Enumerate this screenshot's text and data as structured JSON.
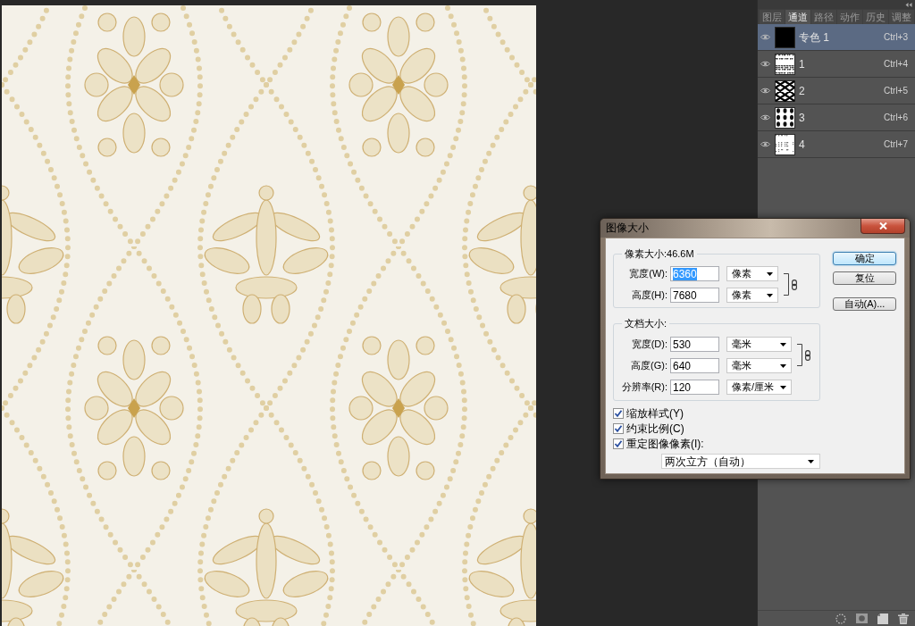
{
  "panel": {
    "tabs": [
      {
        "label": "图层",
        "selected": false
      },
      {
        "label": "通道",
        "selected": true
      },
      {
        "label": "路径",
        "selected": false
      },
      {
        "label": "动作",
        "selected": false
      },
      {
        "label": "历史",
        "selected": false
      },
      {
        "label": "调整",
        "selected": false
      }
    ],
    "channels": [
      {
        "name": "专色 1",
        "shortcut": "Ctrl+3",
        "selected": true,
        "visible": true,
        "kind": "solid"
      },
      {
        "name": "1",
        "shortcut": "Ctrl+4",
        "selected": false,
        "visible": true,
        "kind": "speckle"
      },
      {
        "name": "2",
        "shortcut": "Ctrl+5",
        "selected": false,
        "visible": true,
        "kind": "lattice"
      },
      {
        "name": "3",
        "shortcut": "Ctrl+6",
        "selected": false,
        "visible": true,
        "kind": "motif"
      },
      {
        "name": "4",
        "shortcut": "Ctrl+7",
        "selected": false,
        "visible": true,
        "kind": "sparse"
      }
    ]
  },
  "dialog": {
    "title": "图像大小",
    "groups": [
      {
        "legend": "像素大小:46.6M",
        "linked": true,
        "fields": [
          {
            "label": "宽度(W):",
            "value": "6360",
            "unit": "像素",
            "value_selected": true
          },
          {
            "label": "高度(H):",
            "value": "7680",
            "unit": "像素",
            "value_selected": false
          }
        ]
      },
      {
        "legend": "文档大小:",
        "linked": true,
        "fields": [
          {
            "label": "宽度(D):",
            "value": "530",
            "unit": "毫米",
            "value_selected": false
          },
          {
            "label": "高度(G):",
            "value": "640",
            "unit": "毫米",
            "value_selected": false
          },
          {
            "label": "分辨率(R):",
            "value": "120",
            "unit": "像素/厘米",
            "value_selected": false
          }
        ]
      }
    ],
    "checkboxes": [
      {
        "label": "缩放样式(Y)",
        "checked": true
      },
      {
        "label": "约束比例(C)",
        "checked": true
      },
      {
        "label": "重定图像像素(I):",
        "checked": true
      }
    ],
    "resample": {
      "value": "两次立方（自动）"
    },
    "buttons": [
      {
        "label": "确定",
        "default": true
      },
      {
        "label": "复位",
        "default": false
      },
      {
        "label": "自动(A)...",
        "default": false
      }
    ]
  }
}
